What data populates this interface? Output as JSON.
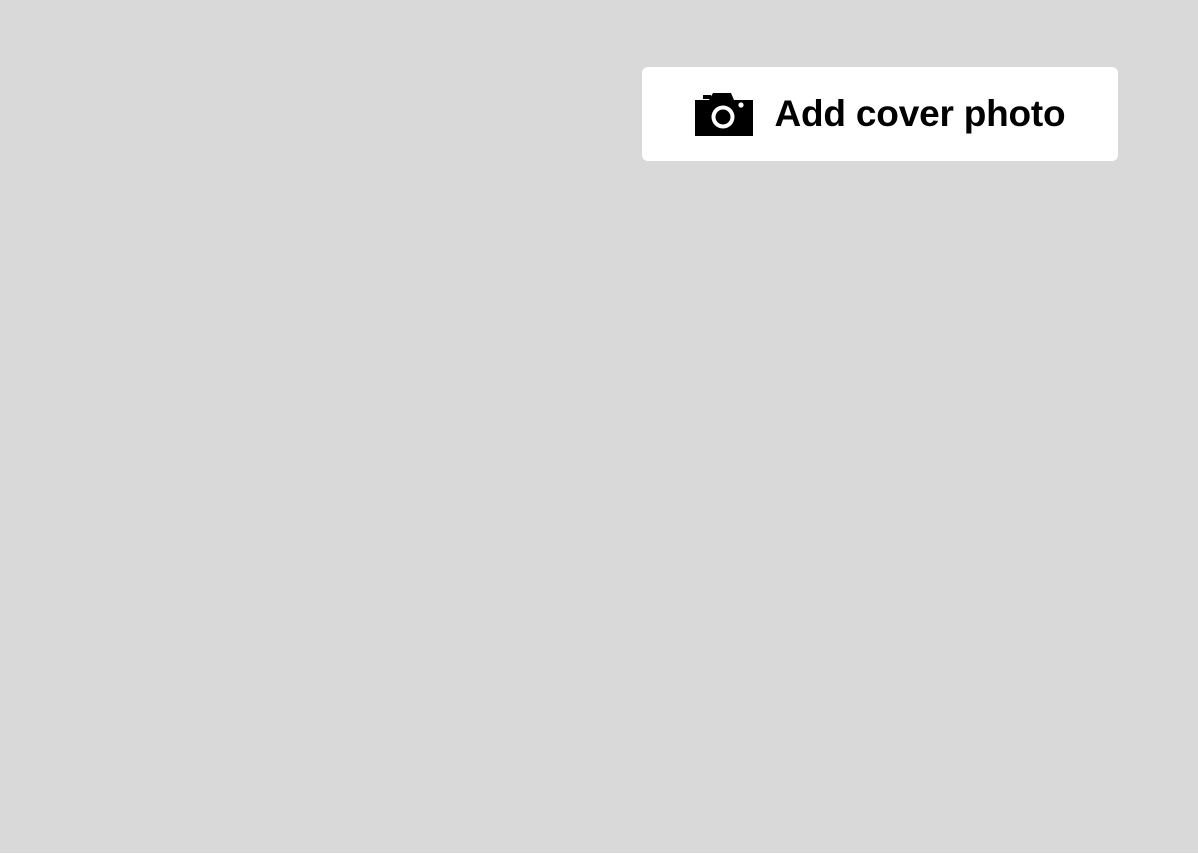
{
  "cover": {
    "background_color": "#d9d9d9",
    "add_button": {
      "label": "Add cover photo",
      "icon": "camera-icon",
      "background_color": "#ffffff",
      "text_color": "#000000"
    }
  }
}
